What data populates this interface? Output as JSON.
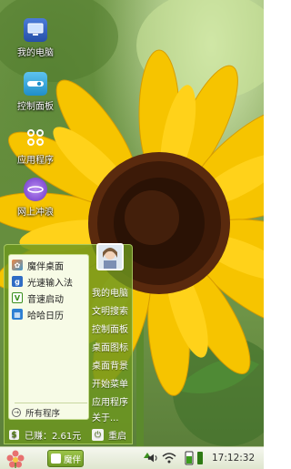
{
  "desktop": {
    "icons": [
      {
        "label": "我的电脑",
        "icon": "computer-icon"
      },
      {
        "label": "控制面板",
        "icon": "control-panel-icon"
      },
      {
        "label": "应用程序",
        "icon": "apps-icon"
      },
      {
        "label": "网上冲浪",
        "icon": "browser-icon"
      }
    ]
  },
  "start_menu": {
    "left_items": [
      {
        "label": "魔伴桌面",
        "icon": "moban-desktop-icon"
      },
      {
        "label": "光速输入法",
        "icon": "input-method-icon"
      },
      {
        "label": "音速启动",
        "icon": "launcher-icon"
      },
      {
        "label": "哈哈日历",
        "icon": "calendar-icon"
      }
    ],
    "all_programs": "所有程序",
    "right_items": [
      "我的电脑",
      "文明搜索",
      "控制面板",
      "桌面图标",
      "桌面背景",
      "开始菜单",
      "应用程序",
      "关于..."
    ],
    "earnings": "已赚：2.61元",
    "restart": "重启"
  },
  "taskbar": {
    "task_label": "魔伴",
    "clock": "17:12:32",
    "tray_icons": [
      "up-arrow-icon",
      "volume-icon",
      "wifi-icon",
      "battery-icon",
      "signal-icon"
    ]
  },
  "colors": {
    "menu_green": "#6c961e",
    "taskbar_bg": "#eef2e4"
  }
}
